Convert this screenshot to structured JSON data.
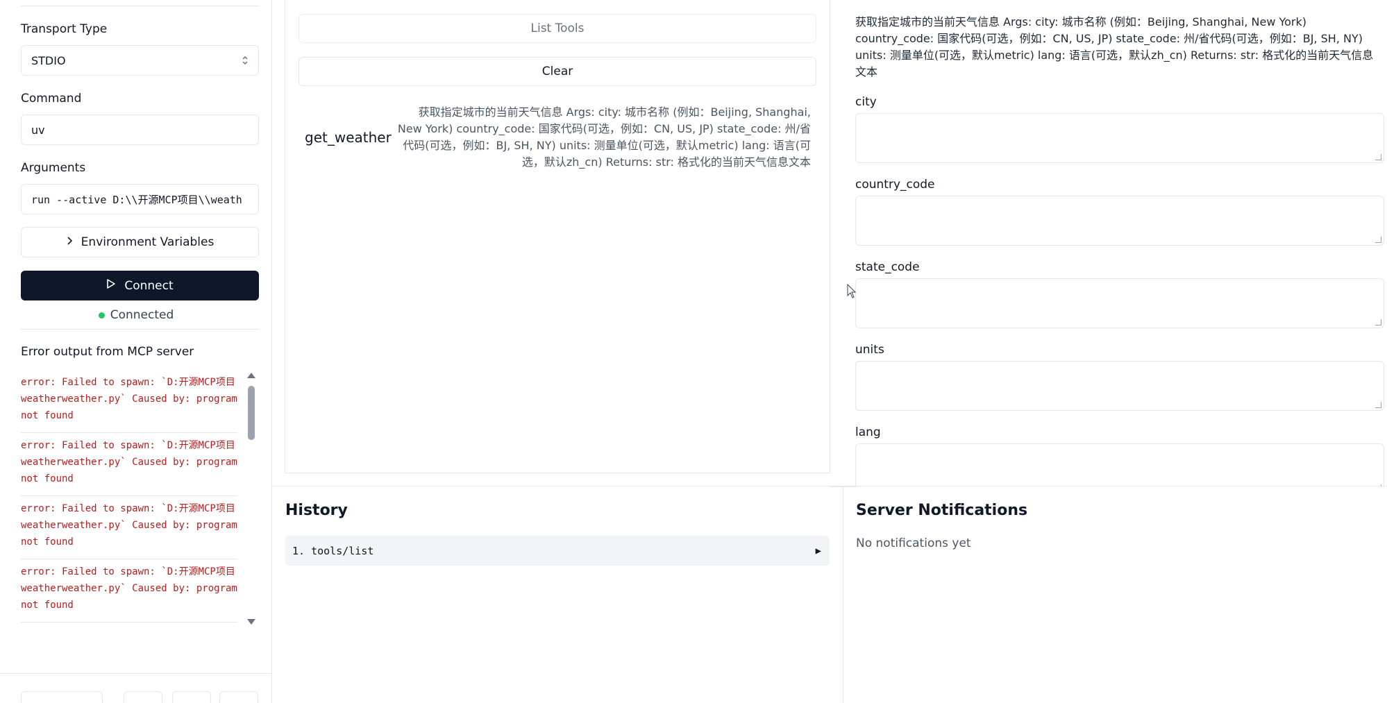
{
  "sidebar": {
    "transport_label": "Transport Type",
    "transport_value": "STDIO",
    "command_label": "Command",
    "command_value": "uv",
    "arguments_label": "Arguments",
    "arguments_value": "run --active D:\\\\开源MCP项目\\\\weath",
    "env_button": "Environment Variables",
    "connect_button": "Connect",
    "status": "Connected",
    "error_title": "Error output from MCP server",
    "errors": [
      "error: Failed to spawn: `D:开源MCP项目weatherweather.py` Caused by: program not found",
      "error: Failed to spawn: `D:开源MCP项目weatherweather.py` Caused by: program not found",
      "error: Failed to spawn: `D:开源MCP项目weatherweather.py` Caused by: program not found",
      "error: Failed to spawn: `D:开源MCP项目weatherweather.py` Caused by: program not found"
    ]
  },
  "tools": {
    "list_button": "List Tools",
    "clear_button": "Clear",
    "items": [
      {
        "name": "get_weather",
        "description": "获取指定城市的当前天气信息 Args: city: 城市名称 (例如：Beijing, Shanghai, New York) country_code: 国家代码(可选，例如：CN, US, JP) state_code: 州/省代码(可选，例如：BJ, SH, NY) units: 测量单位(可选，默认metric) lang: 语言(可选，默认zh_cn) Returns: str: 格式化的当前天气信息文本"
      }
    ]
  },
  "detail": {
    "description": "获取指定城市的当前天气信息 Args: city: 城市名称 (例如：Beijing, Shanghai, New York) country_code: 国家代码(可选，例如：CN, US, JP) state_code: 州/省代码(可选，例如：BJ, SH, NY) units: 测量单位(可选，默认metric) lang: 语言(可选，默认zh_cn) Returns: str: 格式化的当前天气信息文本",
    "fields": [
      "city",
      "country_code",
      "state_code",
      "units",
      "lang"
    ]
  },
  "history": {
    "title": "History",
    "items": [
      "1. tools/list"
    ]
  },
  "notifications": {
    "title": "Server Notifications",
    "empty": "No notifications yet"
  }
}
